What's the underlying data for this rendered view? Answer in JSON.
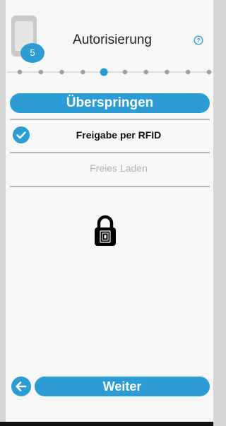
{
  "header": {
    "title": "Autorisierung",
    "step_number": "5",
    "step_icon": "device-icon",
    "help_icon": "question-circle-icon"
  },
  "stepper": {
    "total_steps": 10,
    "current_step": 5
  },
  "skip_label": "Überspringen",
  "options": [
    {
      "label": "Freigabe per RFID",
      "selected": true,
      "icon": "check-circle-icon"
    },
    {
      "label": "Freies Laden",
      "selected": false
    }
  ],
  "lock_icon": "rfid-lock-icon",
  "nav": {
    "back_icon": "arrow-left-icon",
    "next_label": "Weiter"
  },
  "colors": {
    "accent": "#2b9cd4",
    "divider": "#b9b9b9",
    "disabled_text": "#b3b3b3",
    "background": "#f7f7f7"
  }
}
